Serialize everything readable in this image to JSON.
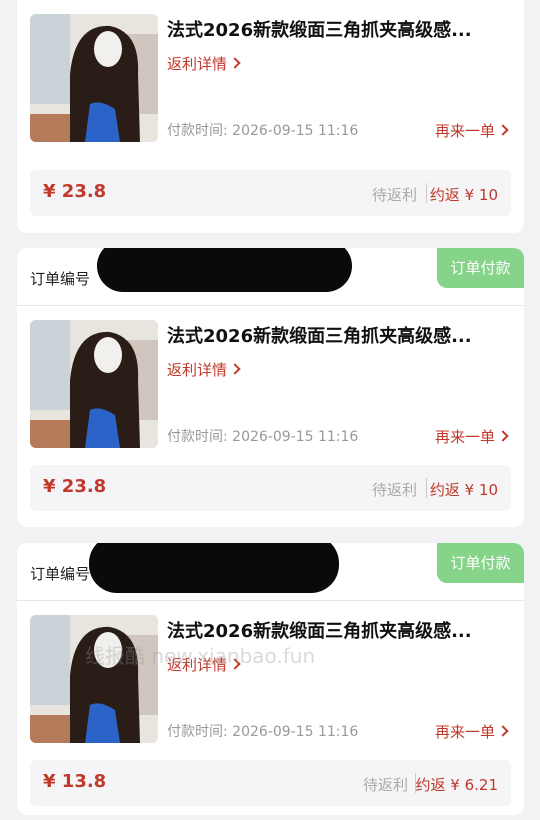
{
  "orders": [
    {
      "title": "法式2026新款缎面三角抓夹高级感...",
      "rebate_details": "返利详情",
      "pay_time": "付款时间: 2026-09-15 11:16",
      "reorder": "再来一单",
      "price": "¥ 23.8",
      "rebate_status": "待返利",
      "rebate_amount": "约返 ¥ 10"
    },
    {
      "order_label": "订单编号",
      "status": "订单付款",
      "title": "法式2026新款缎面三角抓夹高级感...",
      "rebate_details": "返利详情",
      "pay_time": "付款时间: 2026-09-15 11:16",
      "reorder": "再来一单",
      "price": "¥ 23.8",
      "rebate_status": "待返利",
      "rebate_amount": "约返 ¥ 10"
    },
    {
      "order_label": "订单编号",
      "status": "订单付款",
      "title": "法式2026新款缎面三角抓夹高级感...",
      "rebate_details": "返利详情",
      "pay_time": "付款时间: 2026-09-15 11:16",
      "reorder": "再来一单",
      "price": "¥ 13.8",
      "rebate_status": "待返利",
      "rebate_amount": "约返 ¥ 6.21"
    }
  ],
  "watermark": "线报酷 new.xianbao.fun"
}
